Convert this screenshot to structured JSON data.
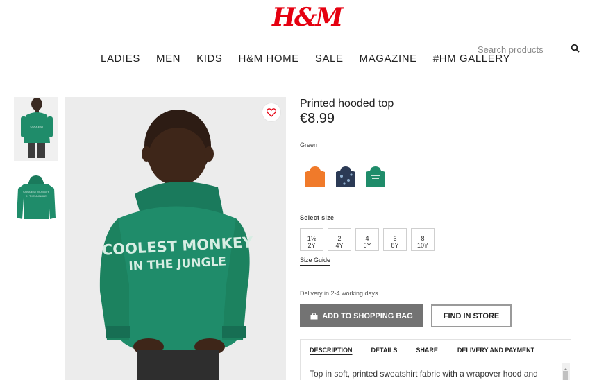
{
  "header": {
    "logo": "H&M",
    "nav": [
      "LADIES",
      "MEN",
      "KIDS",
      "H&M HOME",
      "SALE",
      "MAGAZINE",
      "#HM GALLERY"
    ],
    "search_placeholder": "Search products"
  },
  "product": {
    "title": "Printed hooded top",
    "price": "€8.99",
    "color_name": "Green",
    "swatches": [
      {
        "name": "orange",
        "color": "#f07a2a"
      },
      {
        "name": "navy",
        "color": "#2b3a55"
      },
      {
        "name": "green",
        "color": "#1f8c6a"
      }
    ],
    "select_size_label": "Select size",
    "sizes": [
      {
        "top": "1½",
        "bottom": "2Y"
      },
      {
        "top": "2",
        "bottom": "4Y"
      },
      {
        "top": "4",
        "bottom": "6Y"
      },
      {
        "top": "6",
        "bottom": "8Y"
      },
      {
        "top": "8",
        "bottom": "10Y"
      }
    ],
    "size_guide_label": "Size Guide",
    "delivery_text": "Delivery in 2-4 working days.",
    "add_to_bag_label": "ADD TO SHOPPING BAG",
    "find_in_store_label": "FIND IN STORE"
  },
  "tabs": {
    "items": [
      "DESCRIPTION",
      "DETAILS",
      "SHARE",
      "DELIVERY AND PAYMENT"
    ],
    "active": "DESCRIPTION",
    "description_text": "Top in soft, printed sweatshirt fabric with a wrapover hood and"
  },
  "image_print": {
    "line1": "COOLEST MONKEY",
    "line2": "IN THE JUNGLE"
  },
  "colors": {
    "brand_red": "#e50010",
    "hoodie_green": "#1f8c6a",
    "button_grey": "#737373"
  }
}
